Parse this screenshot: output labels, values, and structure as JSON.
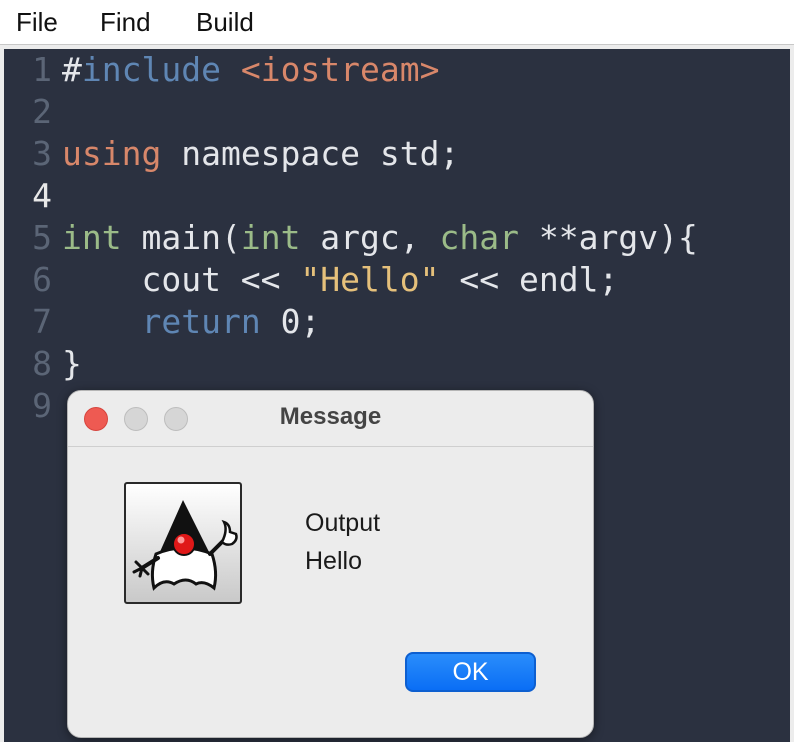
{
  "menu": {
    "items": [
      "File",
      "Find",
      "Build"
    ]
  },
  "editor": {
    "current_line": "4",
    "lines": [
      {
        "num": "1",
        "tokens": [
          {
            "t": "#",
            "c": "kw-pre"
          },
          {
            "t": "include",
            "c": "kw-blue"
          },
          {
            "t": " ",
            "c": "plain"
          },
          {
            "t": "<iostream>",
            "c": "kw-orange"
          }
        ]
      },
      {
        "num": "2",
        "tokens": []
      },
      {
        "num": "3",
        "tokens": [
          {
            "t": "using",
            "c": "kw-orange"
          },
          {
            "t": " namespace std;",
            "c": "plain"
          }
        ]
      },
      {
        "num": "4",
        "tokens": []
      },
      {
        "num": "5",
        "tokens": [
          {
            "t": "int",
            "c": "kw-green"
          },
          {
            "t": " main(",
            "c": "plain"
          },
          {
            "t": "int",
            "c": "kw-green"
          },
          {
            "t": " argc, ",
            "c": "plain"
          },
          {
            "t": "char",
            "c": "kw-green"
          },
          {
            "t": " **argv){",
            "c": "plain"
          }
        ]
      },
      {
        "num": "6",
        "tokens": [
          {
            "t": "    cout << ",
            "c": "plain"
          },
          {
            "t": "\"Hello\"",
            "c": "str"
          },
          {
            "t": " << endl;",
            "c": "plain"
          }
        ]
      },
      {
        "num": "7",
        "tokens": [
          {
            "t": "    ",
            "c": "plain"
          },
          {
            "t": "return",
            "c": "kw-blue"
          },
          {
            "t": " 0;",
            "c": "plain"
          }
        ]
      },
      {
        "num": "8",
        "tokens": [
          {
            "t": "}",
            "c": "plain"
          }
        ]
      },
      {
        "num": "9",
        "tokens": []
      }
    ]
  },
  "dialog": {
    "title": "Message",
    "icon": "duke-java-mascot-icon",
    "message_lines": [
      "Output",
      "Hello"
    ],
    "ok_label": "OK"
  },
  "colors": {
    "editor_bg": "#2b3140",
    "keyword_blue": "#5f86b4",
    "keyword_orange": "#d8876a",
    "keyword_green": "#9bbb88",
    "string_yellow": "#e5c07b",
    "ok_button": "#0a6ef5",
    "close_button": "#ee5a52"
  }
}
